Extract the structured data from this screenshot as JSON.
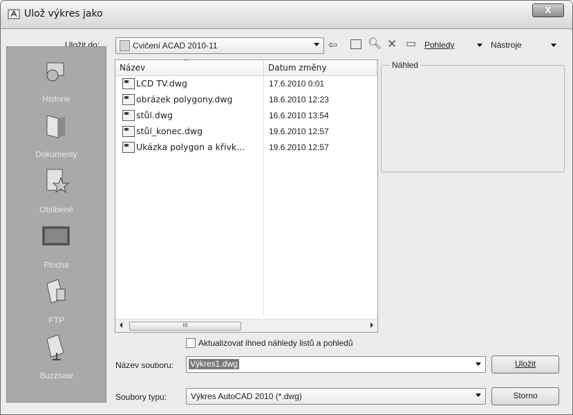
{
  "window": {
    "title": "Ulož výkres jako",
    "close_label": "X"
  },
  "toolbar": {
    "save_in_label": "Uložit do:",
    "folder": "Cvičení ACAD 2010-11",
    "views_label": "Pohledy",
    "tools_label": "Nástroje"
  },
  "places": [
    {
      "label": "Historie",
      "icon": "history-icon"
    },
    {
      "label": "Dokumenty",
      "icon": "documents-folder-icon"
    },
    {
      "label": "Oblíbené",
      "icon": "favorites-icon"
    },
    {
      "label": "Plocha",
      "icon": "desktop-icon"
    },
    {
      "label": "FTP",
      "icon": "ftp-icon"
    },
    {
      "label": "Buzzsaw",
      "icon": "buzzsaw-icon"
    }
  ],
  "file_list": {
    "columns": [
      "Název",
      "Datum změny"
    ],
    "files": [
      {
        "name": "LCD TV.dwg",
        "date": "17.6.2010 0:01"
      },
      {
        "name": "obrázek polygony.dwg",
        "date": "18.6.2010 12:23"
      },
      {
        "name": "stůl.dwg",
        "date": "16.6.2010 13:54"
      },
      {
        "name": "stůl_konec.dwg",
        "date": "19.6.2010 12:57"
      },
      {
        "name": "Ukázka polygon a křivk...",
        "date": "19.6.2010 12:57"
      }
    ],
    "scroll_thumb": "III"
  },
  "preview": {
    "label": "Náhled"
  },
  "options": {
    "update_thumbnails": "Aktualizovat ihned náhledy listů a pohledů",
    "update_thumbnails_checked": false
  },
  "filename": {
    "label": "Název souboru:",
    "value": "Výkres1.dwg"
  },
  "filetype": {
    "label": "Soubory typu:",
    "value": "Výkres AutoCAD 2010 (*.dwg)"
  },
  "buttons": {
    "save": "Uložit",
    "cancel": "Storno"
  }
}
